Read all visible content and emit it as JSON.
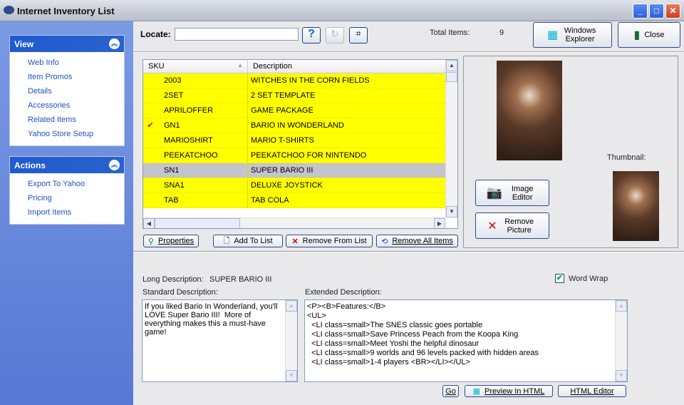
{
  "window": {
    "title": "Internet Inventory List"
  },
  "sidebar": {
    "view": {
      "title": "View",
      "items": [
        "Web Info",
        "Item Promos",
        "Details",
        "Accessories",
        "Related Items",
        "Yahoo Store Setup"
      ]
    },
    "actions": {
      "title": "Actions",
      "items": [
        "Export To Yahoo",
        "Pricing",
        "Import Items"
      ]
    }
  },
  "toolbar": {
    "locate_label": "Locate:",
    "locate_value": "",
    "total_label": "Total Items:",
    "total_value": "9",
    "windows_explorer": "Windows Explorer",
    "close": "Close"
  },
  "grid": {
    "columns": [
      "SKU",
      "Description"
    ],
    "rows": [
      {
        "sku": "2003",
        "desc": "WITCHES IN THE CORN FIELDS",
        "check": ""
      },
      {
        "sku": "2SET",
        "desc": "2 SET TEMPLATE",
        "check": ""
      },
      {
        "sku": "APRILOFFER",
        "desc": "GAME PACKAGE",
        "check": ""
      },
      {
        "sku": "GN1",
        "desc": "BARIO IN WONDERLAND",
        "check": "✔"
      },
      {
        "sku": "MARIOSHIRT",
        "desc": "MARIO T-SHIRTS",
        "check": ""
      },
      {
        "sku": "PEEKATCHOO",
        "desc": "PEEKATCHOO FOR NINTENDO",
        "check": ""
      },
      {
        "sku": "SN1",
        "desc": "SUPER BARIO III",
        "check": "",
        "selected": true
      },
      {
        "sku": "SNA1",
        "desc": "DELUXE JOYSTICK",
        "check": ""
      },
      {
        "sku": "TAB",
        "desc": "TAB COLA",
        "check": ""
      }
    ]
  },
  "grid_buttons": {
    "properties": "Properties",
    "add": "Add To List",
    "remove": "Remove From List",
    "remove_all": "Remove All Items"
  },
  "image_panel": {
    "thumbnail_label": "Thumbnail:",
    "image_editor": "Image Editor",
    "remove_picture": "Remove Picture"
  },
  "details": {
    "long_label": "Long Description:",
    "long_value": "SUPER BARIO III",
    "word_wrap": "Word Wrap",
    "word_wrap_checked": true,
    "standard_label": "Standard Description:",
    "standard_value": "If you liked Bario In Wonderland, you'll LOVE Super Bario III!  More of everything makes this a must-have game!",
    "extended_label": "Extended Description:",
    "extended_value": "<P><B>Features:</B>\n<UL>\n  <LI class=small>The SNES classic goes portable\n  <LI class=small>Save Princess Peach from the Koopa King\n  <LI class=small>Meet Yoshi the helpful dinosaur\n  <LI class=small>9 worlds and 96 levels packed with hidden areas\n  <LI class=small>1-4 players <BR></LI></UL>",
    "go": "Go",
    "preview": "Preview In HTML",
    "html_editor": "HTML Editor"
  },
  "colors": {
    "highlight_row": "#ffff00",
    "selected_row": "#c4c4cc",
    "sidebar_header": "#1f5bd0"
  }
}
